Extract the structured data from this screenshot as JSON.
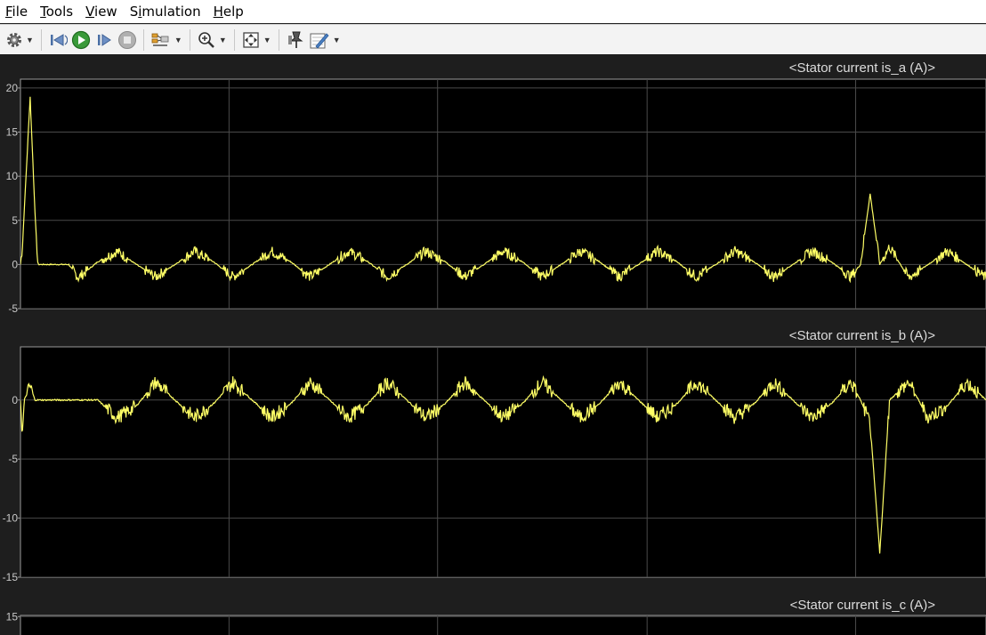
{
  "menu": {
    "items": [
      {
        "label": "File",
        "accel": "F",
        "rest": "ile"
      },
      {
        "label": "Tools",
        "accel": "T",
        "rest": "ools"
      },
      {
        "label": "View",
        "accel": "V",
        "rest": "iew"
      },
      {
        "label": "Simulation",
        "accel": "i",
        "pre": "S",
        "rest": "mulation"
      },
      {
        "label": "Help",
        "accel": "H",
        "rest": "elp"
      }
    ]
  },
  "toolbar": {
    "icons": [
      "gear-icon",
      "step-back-icon",
      "run-icon",
      "step-forward-icon",
      "stop-icon",
      "signal-trigger-icon",
      "zoom-in-icon",
      "fit-to-view-icon",
      "pin-icon",
      "highlight-pen-icon"
    ]
  },
  "colors": {
    "trace": "#ffff66",
    "plot_bg": "#000000",
    "figure_bg": "#1e1e1e",
    "grid": "#4a4a4a",
    "axis_text": "#c8c8c8",
    "title_text": "#dcdcdc"
  },
  "chart_data": [
    {
      "type": "line",
      "title": "<Stator current is_a (A)>",
      "xlabel": "",
      "ylabel": "",
      "ylim": [
        -5,
        21
      ],
      "yticks": [
        20,
        15,
        10,
        5,
        0,
        -5
      ],
      "grid": true,
      "series": [
        {
          "shape": "phase_a",
          "x": [
            0,
            0.002,
            0.01,
            0.015,
            0.018,
            0.03,
            0.04,
            0.05,
            0.06,
            0.08,
            0.1,
            0.12,
            0.14,
            0.16,
            0.18,
            0.2,
            0.22,
            0.24,
            0.26,
            0.28,
            0.3,
            0.32,
            0.34,
            0.36,
            0.38,
            0.4,
            0.42,
            0.44,
            0.46,
            0.48,
            0.5,
            0.52,
            0.54,
            0.56,
            0.58,
            0.6,
            0.62,
            0.64,
            0.66,
            0.68,
            0.7,
            0.72,
            0.74,
            0.76,
            0.78,
            0.8,
            0.82,
            0.84,
            0.86,
            0.87,
            0.88,
            0.89,
            0.9,
            0.92,
            0.94,
            0.96,
            0.98,
            1.0
          ],
          "y": [
            0,
            2,
            19,
            6,
            0,
            0,
            0,
            0,
            -1.5,
            0.3,
            1.5,
            0,
            -1.4,
            0,
            1.5,
            0.3,
            -1.4,
            0,
            1.5,
            0.3,
            -1.4,
            0,
            1.5,
            0.3,
            -1.4,
            0,
            1.5,
            0.3,
            -1.4,
            0,
            1.5,
            0.3,
            -1.4,
            0,
            1.5,
            0.3,
            -1.4,
            0,
            1.5,
            0.3,
            -1.4,
            0,
            1.5,
            0.3,
            -1.4,
            0,
            1.5,
            0.3,
            -1.4,
            0,
            8,
            0,
            2,
            -1.5,
            0,
            1.5,
            0,
            -1.5
          ]
        }
      ]
    },
    {
      "type": "line",
      "title": "<Stator current is_b (A)>",
      "xlabel": "",
      "ylabel": "",
      "ylim": [
        -15,
        4.5
      ],
      "yticks": [
        0,
        -5,
        -10,
        -15
      ],
      "grid": true,
      "series": [
        {
          "shape": "phase_b",
          "x": [
            0,
            0.002,
            0.004,
            0.01,
            0.015,
            0.02,
            0.08,
            0.1,
            0.12,
            0.14,
            0.16,
            0.18,
            0.2,
            0.22,
            0.24,
            0.26,
            0.28,
            0.3,
            0.32,
            0.34,
            0.36,
            0.38,
            0.4,
            0.42,
            0.44,
            0.46,
            0.48,
            0.5,
            0.52,
            0.54,
            0.56,
            0.58,
            0.6,
            0.62,
            0.64,
            0.66,
            0.68,
            0.7,
            0.72,
            0.74,
            0.76,
            0.78,
            0.8,
            0.82,
            0.84,
            0.86,
            0.87,
            0.88,
            0.89,
            0.9,
            0.92,
            0.94,
            0.96,
            0.98,
            1.0
          ],
          "y": [
            0,
            -3,
            0,
            1.2,
            0,
            0,
            0,
            -1.5,
            -0.5,
            1.5,
            0,
            -1.5,
            -0.3,
            1.5,
            0,
            -1.5,
            -0.3,
            1.5,
            0,
            -1.5,
            -0.3,
            1.5,
            0,
            -1.5,
            -0.3,
            1.5,
            0,
            -1.5,
            -0.3,
            1.5,
            0,
            -1.5,
            -0.3,
            1.5,
            0,
            -1.5,
            -0.3,
            1.5,
            0,
            -1.5,
            -0.3,
            1.5,
            0,
            -1.5,
            -0.3,
            1.5,
            0,
            -2,
            -13,
            0,
            1.5,
            -1.5,
            -0.5,
            1.5,
            0
          ]
        }
      ]
    },
    {
      "type": "line",
      "title": "<Stator current is_c (A)>",
      "xlabel": "",
      "ylabel": "",
      "ylim": [
        -15,
        16
      ],
      "yticks": [
        15
      ],
      "grid": true,
      "series": []
    }
  ]
}
